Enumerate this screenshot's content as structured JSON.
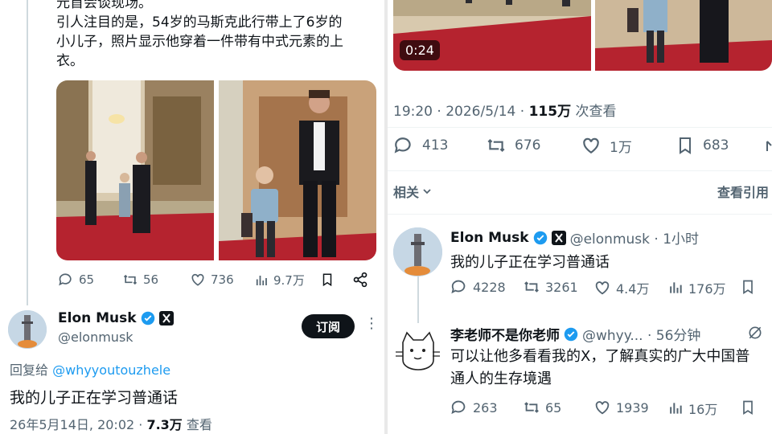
{
  "left_post": {
    "body_lines": [
      "元首会谈现场。",
      "引人注目的是，54岁的马斯克此行带上了6岁的",
      "小儿子，照片显示他穿着一件带有中式元素的上",
      "衣。"
    ],
    "actions": {
      "replies": "65",
      "reposts": "56",
      "likes": "736",
      "views": "9.7万"
    }
  },
  "left_reply": {
    "name": "Elon Musk",
    "handle": "@elonmusk",
    "subscribe_label": "订阅",
    "reply_to_prefix": "回复给",
    "reply_to_handle": "@whyyoutouzhele",
    "text": "我的儿子正在学习普通话",
    "meta_date": "26年5月14日, 20:02 · ",
    "meta_views": "7.3万",
    "meta_suffix": " 查看"
  },
  "right_main": {
    "video_time": "0:24",
    "meta_time": "19:20 · 2026/5/14 · ",
    "meta_views": "115万",
    "meta_suffix": " 次查看",
    "actions": {
      "replies": "413",
      "reposts": "676",
      "likes": "1万",
      "bookmarks": "683"
    },
    "related_label": "相关",
    "quotes_label": "查看引用"
  },
  "right_reply1": {
    "name": "Elon Musk",
    "handle_time": "@elonmusk · 1小时",
    "text": "我的儿子正在学习普通话",
    "actions": {
      "replies": "4228",
      "reposts": "3261",
      "likes": "4.4万",
      "views": "176万"
    }
  },
  "right_reply2": {
    "name": "李老师不是你老师",
    "handle_time": "@whyy... · 56分钟",
    "text_line1": "可以让他多看看我的X，了解真实的广大中国普",
    "text_line2": "通人的生存境遇",
    "actions": {
      "replies": "263",
      "reposts": "65",
      "likes": "1939",
      "views": "16万"
    }
  },
  "colors": {
    "accent": "#1d9bf0",
    "muted": "#536471",
    "dark": "#0f1419",
    "carpet": "#b5232f"
  }
}
